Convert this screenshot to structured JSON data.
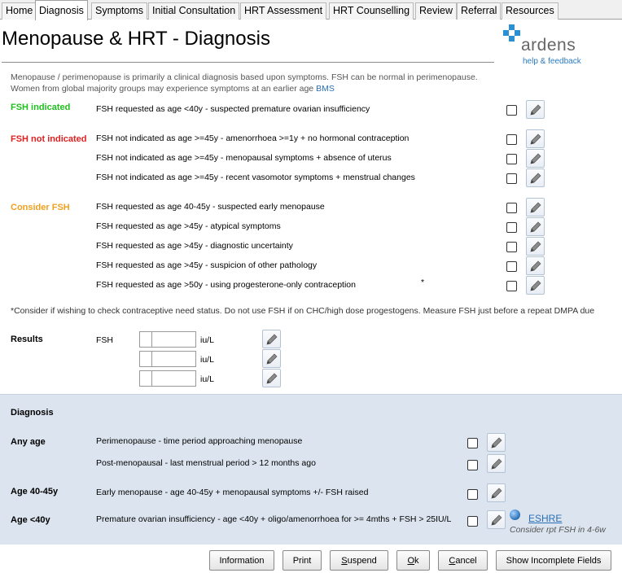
{
  "tabs": [
    "Home",
    "Diagnosis",
    "Symptoms",
    "Initial Consultation",
    "HRT Assessment",
    "HRT Counselling",
    "Review",
    "Referral",
    "Resources"
  ],
  "active_tab": "Diagnosis",
  "title": "Menopause & HRT - Diagnosis",
  "logo": {
    "name": "ardens",
    "help": "help & feedback"
  },
  "intro": {
    "line1": "Menopause / perimenopause is primarily a clinical diagnosis based upon symptoms. FSH can be normal in perimenopause.",
    "line2": "Women from global majority groups may experience symptoms at an earlier age",
    "link": "BMS"
  },
  "sections": {
    "fsh_indicated": {
      "label": "FSH indicated",
      "rows": [
        "FSH requested as age <40y - suspected premature ovarian insufficiency"
      ]
    },
    "fsh_not_indicated": {
      "label": "FSH not indicated",
      "rows": [
        "FSH not indicated as age >=45y - amenorrhoea >=1y + no hormonal contraception",
        "FSH not indicated as age >=45y - menopausal symptoms + absence of uterus",
        "FSH not indicated as age >=45y - recent vasomotor symptoms + menstrual changes"
      ]
    },
    "consider_fsh": {
      "label": "Consider FSH",
      "rows": [
        "FSH requested as age 40-45y - suspected early menopause",
        "FSH requested as age >45y - atypical symptoms",
        "FSH requested as age >45y - diagnostic uncertainty",
        "FSH requested as age >45y - suspicion of other pathology",
        "FSH requested as age >50y - using progesterone-only contraception"
      ],
      "asterisk": "*"
    }
  },
  "footnote": "*Consider if wishing to check contraceptive need status. Do not use FSH if on CHC/high dose progestogens. Measure FSH just before a repeat DMPA due",
  "results": {
    "label": "Results",
    "fsh_label": "FSH",
    "unit": "iu/L",
    "values": [
      "",
      "",
      ""
    ]
  },
  "diagnosis": {
    "heading": "Diagnosis",
    "any_age_label": "Any age",
    "any_age_rows": [
      "Perimenopause - time period approaching menopause",
      "Post-menopausal - last menstrual period > 12 months ago"
    ],
    "age_40_45_label": "Age 40-45y",
    "age_40_45_row": "Early menopause - age 40-45y + menopausal symptoms +/- FSH raised",
    "age_lt40_label": "Age <40y",
    "age_lt40_row": "Premature ovarian insufficiency - age <40y + oligo/amenorrhoea for >= 4mths + FSH > 25IU/L",
    "link": "ESHRE",
    "hint": "Consider rpt FSH in 4-6w"
  },
  "buttons": {
    "information": "Information",
    "print": "Print",
    "suspend_u": "S",
    "suspend_rest": "uspend",
    "ok_u": "O",
    "ok_rest": "k",
    "cancel_u": "C",
    "cancel_rest": "ancel",
    "show_incomplete": "Show Incomplete Fields"
  },
  "colors": {
    "green": "#1fbf1f",
    "red": "#e02020",
    "orange": "#f0a020",
    "link": "#2a6fb5",
    "panel": "#dce5ef",
    "logo": "#2b8fd3"
  }
}
